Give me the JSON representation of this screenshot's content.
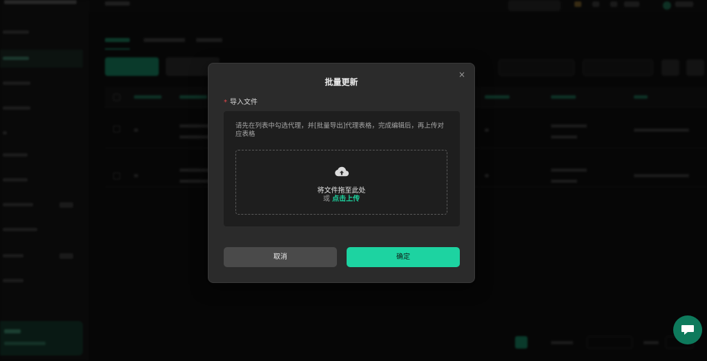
{
  "modal": {
    "title": "批量更新",
    "close_glyph": "×",
    "required_mark": "*",
    "field_label": "导入文件",
    "hint_text": "请先在列表中勾选代理，并[批量导出]代理表格，完成编辑后，再上传对应表格",
    "dropzone": {
      "icon": "cloud-upload-icon",
      "text": "将文件拖至此处",
      "or": "或",
      "link": "点击上传"
    },
    "cancel_label": "取消",
    "confirm_label": "确定"
  },
  "chat": {
    "icon": "chat-bubble-icon"
  },
  "colors": {
    "accent": "#1dd3a1",
    "modal_bg": "#2b2b2b",
    "panel_bg": "#1e1e1e",
    "cancel_bg": "#4a4a4a",
    "required": "#e5484d",
    "chat": "#0e7a5c"
  }
}
